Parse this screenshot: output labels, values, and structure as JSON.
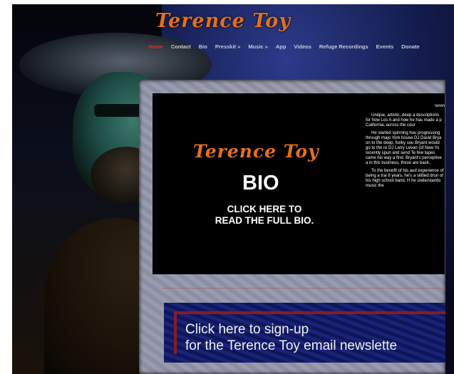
{
  "site": {
    "logo_text": "Terence Toy"
  },
  "nav": {
    "items": [
      "Home",
      "Contact",
      "Bio",
      "Presskit »",
      "Music »",
      "App",
      "Videos",
      "Refuge Recordings",
      "Events",
      "Donate"
    ],
    "active": "Home"
  },
  "bio": {
    "logo_text": "Terence Toy",
    "title": "BIO",
    "click_line1": "CLICK HERE TO",
    "click_line2": "READ THE FULL BIO.",
    "text_title": "Teren",
    "paragraphs": [
      "Unique, artistic, deep a descriptions for how Los A and how he has made a p California, across the cour",
      "He started spinning hou progressing through majo York house DJ David Brya on to the deep, funky sou Bryant would go to the re DJ Larry Levan (of New Yo recently spun and send Te few tapes came his way a find. Bryant's perceptive a in this business, these are back.",
      "To the benefit of his aud experience of being a trai 8 years, he's a skilled drun of his high school band. H he understands music the"
    ]
  },
  "newsletter": {
    "line1": "Click here to sign-up",
    "line2": "for the Terence Toy email newslette"
  }
}
